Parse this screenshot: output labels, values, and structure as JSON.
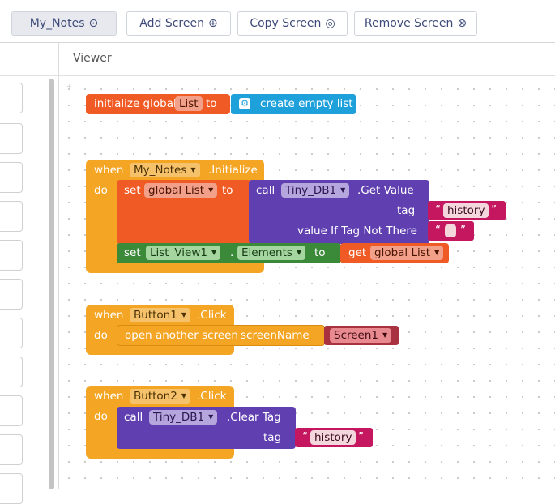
{
  "toolbar": {
    "screen_select": "My_Notes",
    "add_screen": "Add Screen",
    "copy_screen": "Copy Screen",
    "remove_screen": "Remove Screen"
  },
  "viewer": {
    "title": "Viewer"
  },
  "blocks": {
    "init": {
      "label": "initialize global",
      "var_name": "List",
      "to": "to",
      "create_empty": "create empty list"
    },
    "when1": {
      "when": "when",
      "component": "My_Notes",
      "event": ".Initialize",
      "do": "do",
      "set": "set",
      "global_var": "global List",
      "to": "to",
      "call": "call",
      "db": "Tiny_DB1",
      "method": ".Get Value",
      "tag": "tag",
      "tag_text": "history",
      "value_if": "value If Tag Not There",
      "set2": "set",
      "list_view": "List_View1",
      "dot": ".",
      "prop": "Elements",
      "to2": "to",
      "get": "get",
      "get_var": "global List"
    },
    "when2": {
      "when": "when",
      "component": "Button1",
      "event": ".Click",
      "do": "do",
      "open": "open another screen",
      "screen_name": "screenName",
      "screen_value": "Screen1"
    },
    "when3": {
      "when": "when",
      "component": "Button2",
      "event": ".Click",
      "do": "do",
      "call": "call",
      "db": "Tiny_DB1",
      "method": ".Clear Tag",
      "tag": "tag",
      "tag_text": "history"
    }
  },
  "colors": {
    "event_orange": "#f5a524",
    "variable_orange": "#f05a24",
    "list_blue": "#1ea0db",
    "component_purple": "#6040b0",
    "text_pink": "#c4175f",
    "set_green": "#3a8a3a",
    "control_darkred": "#a83240"
  }
}
